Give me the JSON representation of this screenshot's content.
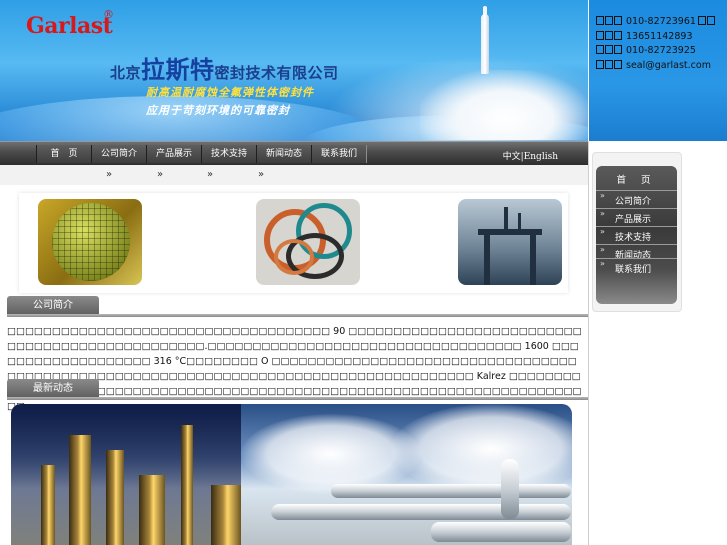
{
  "header": {
    "logo_text": "Garlast",
    "logo_mark": "®",
    "company_prefix": "北京",
    "company_brand": "拉斯特",
    "company_suffix": "密封技术有限公司",
    "slogan_line1": "耐高温耐腐蚀全氟弹性体密封件",
    "slogan_line2": "应用于苛刻环境的可靠密封"
  },
  "contact": {
    "phone": "010-82723961",
    "mobile": "13651142893",
    "fax": "010-82723925",
    "email": "seal@garlast.com"
  },
  "nav": {
    "items": [
      "首　页",
      "公司简介",
      "产品展示",
      "技术支持",
      "新闻动态",
      "联系我们"
    ],
    "language_switch": "中文|English"
  },
  "breadcrumb": {
    "arrows": [
      "»",
      "»",
      "»",
      "»"
    ]
  },
  "sections": {
    "intro_title": "公司简介",
    "intro_text": "□□□□□□□□□□□□□□□□□□□□□□□□□□□□□□□□□□□□ 90 □□□□□□□□□□□□□□□□□□□□□□□□□□□□□□□□□□□□□□□□□□□□□□□□.□□□□□□□□□□□□□□□□□□□□□□□□□□□□□□□□□□□ 1600 □□□□□□□□□□□□□□□□□□□ 316 °C□□□□□□□□ O □□□□□□□□□□□□□□□□□□□□□□□□□□□□□□□□□□□□□□□□□□□□□□□□□□□□□□□□□□□□□□□□□□□□□□□□□□□□□□□□□□□□□□ Kalrez □□□□□□□□□□□□□□□□□□□□□□□□□□□□□□□□□□□□□□□□□□□□□□□□□□□□□□□□□□□□□□□□□□□□□□□□□□",
    "news_title": "最新动态"
  },
  "side_menu": {
    "title": "首 页",
    "items": [
      "公司简介",
      "产品展示",
      "技术支持",
      "新闻动态",
      "联系我们"
    ],
    "bullet": "»"
  },
  "colors": {
    "banner_blue": "#2f9fe6",
    "logo_red": "#d8191c",
    "nav_dark": "#3d3d3d"
  }
}
